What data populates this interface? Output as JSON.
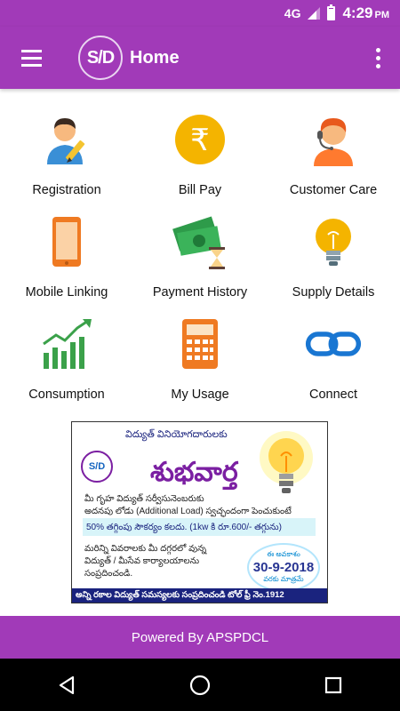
{
  "status_bar": {
    "network": "4G",
    "time": "4:29",
    "ampm": "PM"
  },
  "app_bar": {
    "logo_text": "S/D",
    "title": "Home"
  },
  "tiles": [
    {
      "label": "Registration",
      "icon": "user-pencil-icon"
    },
    {
      "label": "Bill Pay",
      "icon": "rupee-coin-icon"
    },
    {
      "label": "Customer Care",
      "icon": "headset-agent-icon"
    },
    {
      "label": "Mobile Linking",
      "icon": "smartphone-icon"
    },
    {
      "label": "Payment History",
      "icon": "money-hourglass-icon"
    },
    {
      "label": "Supply Details",
      "icon": "light-bulb-icon"
    },
    {
      "label": "Consumption",
      "icon": "growth-chart-icon"
    },
    {
      "label": "My Usage",
      "icon": "calculator-icon"
    },
    {
      "label": "Connect",
      "icon": "chain-link-icon"
    }
  ],
  "banner": {
    "top_text": "విద్యుత్ వినియోగదారులకు",
    "logo_text": "S/D",
    "title": "శుభవార్త",
    "line1": "మీ గృహ విద్యుత్ సర్వీసునెంబరుకు",
    "line2": "అదనపు లోడు (Additional Load) స్వచ్ఛందంగా పెంచుకుంటే",
    "highlight": "50% తగ్గింపు సౌకర్యం కలదు. (1kw కి రూ.600/- తగ్గును)",
    "line3": "మరిన్ని వివరాలకు మీ దగ్గరలో వున్న",
    "line4": "విద్యుత్ / మీసేవ కార్యాలయాలను",
    "line5": "సంప్రదించండి.",
    "date_top": "ఈ అవకాశం",
    "date": "30-9-2018",
    "date_bottom": "వరకు మాత్రమే",
    "footer": "అన్ని రకాల విద్యుత్ సమస్యలకు సంప్రదించండి టోల్ ఫ్రీ నెం.1912"
  },
  "footer": {
    "text": "Powered By APSPDCL"
  },
  "colors": {
    "primary": "#a13ab8",
    "nav_bar": "#000000"
  }
}
